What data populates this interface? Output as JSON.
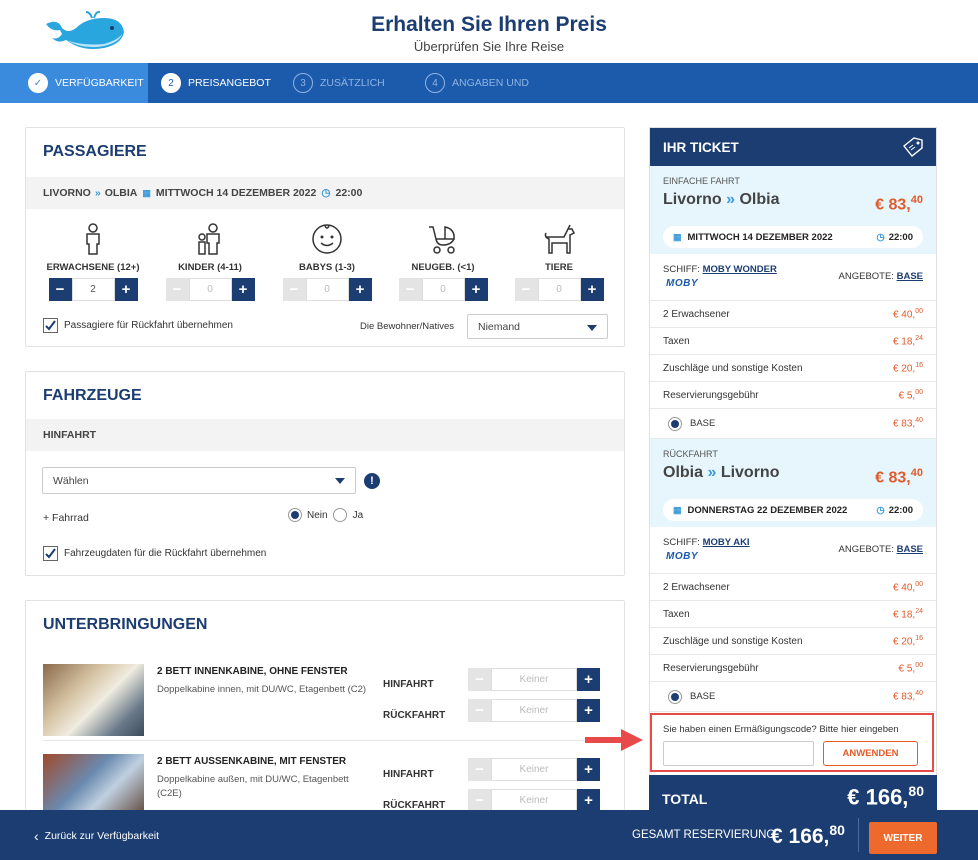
{
  "header": {
    "title": "Erhalten Sie Ihren Preis",
    "subtitle": "Überprüfen Sie Ihre Reise"
  },
  "steps": [
    {
      "num": "✓",
      "label": "VERFÜGBARKEIT"
    },
    {
      "num": "2",
      "label": "PREISANGEBOT"
    },
    {
      "num": "3",
      "label": "ZUSÄTZLICH"
    },
    {
      "num": "4",
      "label": "ANGABEN UND"
    }
  ],
  "passengers": {
    "title": "PASSAGIERE",
    "route_from": "LIVORNO",
    "route_to": "OLBIA",
    "date": "MITTWOCH 14 DEZEMBER 2022",
    "time": "22:00",
    "types": [
      {
        "label": "ERWACHSENE (12+)",
        "value": "2",
        "icon": "adult-icon"
      },
      {
        "label": "KINDER (4-11)",
        "value": "0",
        "icon": "child-icon"
      },
      {
        "label": "BABYS (1-3)",
        "value": "0",
        "icon": "baby-icon"
      },
      {
        "label": "NEUGEB. (<1)",
        "value": "0",
        "icon": "stroller-icon"
      },
      {
        "label": "TIERE",
        "value": "0",
        "icon": "dog-icon"
      }
    ],
    "return_checkbox": "Passagiere für Rückfahrt übernehmen",
    "residents_label": "Die Bewohner/Natives",
    "residents_value": "Niemand"
  },
  "vehicles": {
    "title": "FAHRZEUGE",
    "outbound": "HINFAHRT",
    "select": "Wählen",
    "bike": "+ Fahrrad",
    "no": "Nein",
    "yes": "Ja",
    "return_checkbox": "Fahrzeugdaten für die Rückfahrt übernehmen"
  },
  "accommodations": {
    "title": "UNTERBRINGUNGEN",
    "items": [
      {
        "name": "2 BETT INNENKABINE, OHNE FENSTER",
        "desc": "Doppelkabine innen, mit DU/WC, Etagenbett (C2)",
        "out": "HINFAHRT",
        "ret": "RÜCKFAHRT",
        "val": "Keiner"
      },
      {
        "name": "2 BETT AUSSENKABINE, MIT FENSTER",
        "desc": "Doppelkabine außen, mit DU/WC, Etagenbett (C2E)",
        "out": "HINFAHRT",
        "ret": "RÜCKFAHRT",
        "val": "Keiner"
      }
    ]
  },
  "ticket": {
    "title": "IHR TICKET",
    "legs": [
      {
        "type": "EINFACHE FAHRT",
        "from": "Livorno",
        "to": "Olbia",
        "price_int": "€ 83,",
        "price_dec": "40",
        "date": "MITTWOCH 14 DEZEMBER 2022",
        "time": "22:00",
        "ship_label": "SCHIFF:",
        "ship": "MOBY WONDER",
        "brand": "MOBY",
        "offer_label": "ANGEBOTE:",
        "offer": "BASE",
        "lines": [
          {
            "label": "2 Erwachsener",
            "int": "€ 40,",
            "dec": "00"
          },
          {
            "label": "Taxen",
            "int": "€ 18,",
            "dec": "24"
          },
          {
            "label": "Zuschläge und sonstige Kosten",
            "int": "€ 20,",
            "dec": "16"
          },
          {
            "label": "Reservierungsgebühr",
            "int": "€ 5,",
            "dec": "00"
          }
        ],
        "base_label": "BASE",
        "base_int": "€ 83,",
        "base_dec": "40"
      },
      {
        "type": "RÜCKFAHRT",
        "from": "Olbia",
        "to": "Livorno",
        "price_int": "€ 83,",
        "price_dec": "40",
        "date": "DONNERSTAG 22 DEZEMBER 2022",
        "time": "22:00",
        "ship_label": "SCHIFF:",
        "ship": "MOBY AKI",
        "brand": "MOBY",
        "offer_label": "ANGEBOTE:",
        "offer": "BASE",
        "lines": [
          {
            "label": "2 Erwachsener",
            "int": "€ 40,",
            "dec": "00"
          },
          {
            "label": "Taxen",
            "int": "€ 18,",
            "dec": "24"
          },
          {
            "label": "Zuschläge und sonstige Kosten",
            "int": "€ 20,",
            "dec": "16"
          },
          {
            "label": "Reservierungsgebühr",
            "int": "€ 5,",
            "dec": "00"
          }
        ],
        "base_label": "BASE",
        "base_int": "€ 83,",
        "base_dec": "40"
      }
    ],
    "discount_prompt": "Sie haben einen Ermäßigungscode? Bitte hier eingeben",
    "discount_placeholder": "",
    "apply": "ANWENDEN",
    "total_label": "TOTAL",
    "total_int": "€ 166,",
    "total_dec": "80"
  },
  "footer": {
    "back": "Zurück zur Verfügbarkeit",
    "total_label": "GESAMT RESERVIERUNG",
    "total_int": "€ 166,",
    "total_dec": "80",
    "next": "WEITER"
  }
}
